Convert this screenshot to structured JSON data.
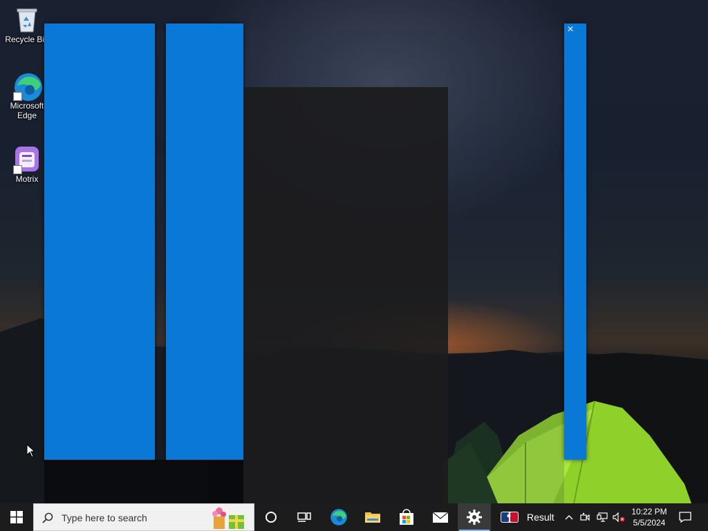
{
  "desktop": {
    "icons": [
      {
        "label": "Recycle Bin",
        "icon": "recycle-bin-icon"
      },
      {
        "label": "Microsoft Edge",
        "icon": "edge-icon"
      },
      {
        "label": "Motrix",
        "icon": "motrix-icon"
      }
    ]
  },
  "snap_view": {
    "close_label": "×"
  },
  "taskbar": {
    "search_placeholder": "Type here to search",
    "news_label": "Result",
    "clock": {
      "time": "10:22 PM",
      "date": "5/5/2024"
    },
    "apps": [
      {
        "name": "cortana",
        "icon": "circle-icon"
      },
      {
        "name": "task-view",
        "icon": "task-view-icon"
      },
      {
        "name": "edge",
        "icon": "edge-icon"
      },
      {
        "name": "file-explorer",
        "icon": "folder-icon"
      },
      {
        "name": "microsoft-store",
        "icon": "store-icon"
      },
      {
        "name": "mail",
        "icon": "mail-icon"
      },
      {
        "name": "settings",
        "icon": "gear-icon",
        "active": true
      }
    ]
  },
  "colors": {
    "accent": "#0a78d7",
    "taskbar": "#1c1c1c",
    "tent": "#8fd12a"
  }
}
